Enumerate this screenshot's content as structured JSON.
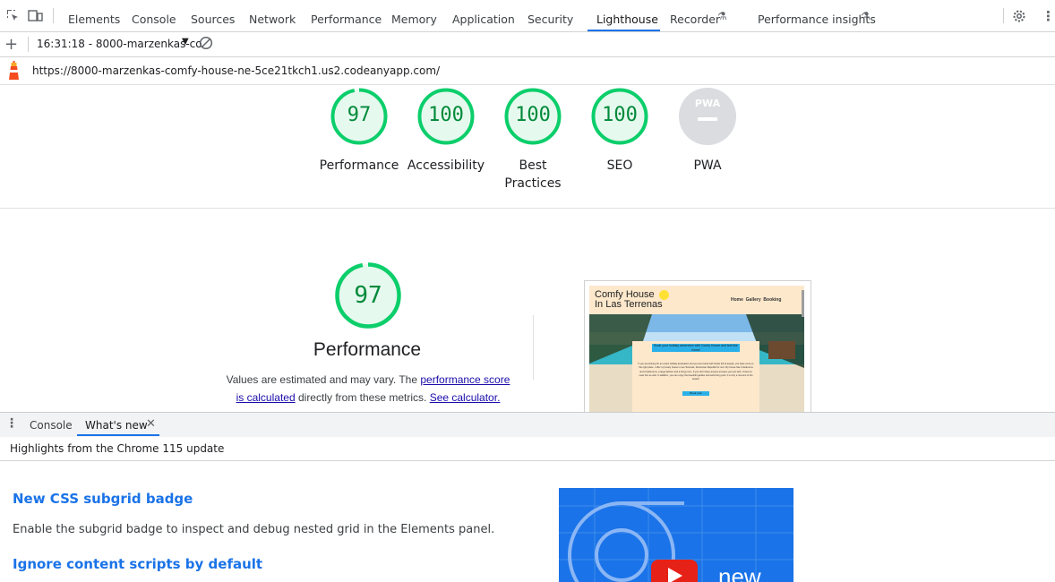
{
  "tabbar": {
    "tabs": [
      {
        "label": "Elements"
      },
      {
        "label": "Console"
      },
      {
        "label": "Sources"
      },
      {
        "label": "Network"
      },
      {
        "label": "Performance"
      },
      {
        "label": "Memory"
      },
      {
        "label": "Application"
      },
      {
        "label": "Security"
      },
      {
        "label": "Lighthouse"
      },
      {
        "label": "Recorder"
      },
      {
        "label": "Performance insights"
      }
    ],
    "active_tab": "Lighthouse"
  },
  "report_toolbar": {
    "report_select": "16:31:18 - 8000-marzenkas-co"
  },
  "url_bar": {
    "url": "https://8000-marzenkas-comfy-house-ne-5ce21tkch1.us2.codeanyapp.com/"
  },
  "scores": [
    {
      "label": "Performance",
      "value": "97",
      "color": "#0cce6b"
    },
    {
      "label": "Accessibility",
      "value": "100",
      "color": "#0cce6b"
    },
    {
      "label": "Best Practices",
      "value": "100",
      "color": "#0cce6b"
    },
    {
      "label": "SEO",
      "value": "100",
      "color": "#0cce6b"
    },
    {
      "label": "PWA",
      "value": "PWA",
      "color": "#dadce0"
    }
  ],
  "performance_detail": {
    "score": "97",
    "title": "Performance",
    "desc_prefix": "Values are estimated and may vary. The ",
    "link1": "performance score is calculated",
    "desc_mid": " directly from these metrics. ",
    "link2": "See calculator."
  },
  "screenshot_preview": {
    "site_title_line1": "Comfy House",
    "site_title_line2": "In Las Terrenas",
    "nav": "Home  Gallery  Booking",
    "card_heading": "Book your holiday adventure with Comfy House and feel like home!",
    "card_text": "If you are looking for an exotic holiday destination and you are bored with hotels full of people, you have come to the right place. I offer my lovely house in Las Terrenas, Dominican Republic for rent. My house has 4 bedrooms and 2 bathrooms, a large kitchen and a living room. If you don't have anyone to leave your pet with, I'd love to meet him as well. In addition, you can enjoy the beautiful garden and swimming pool. It is only a moment to the beach!",
    "card_button": "Book now"
  },
  "drawer": {
    "tabs": [
      {
        "label": "Console"
      },
      {
        "label": "What's new"
      }
    ],
    "highlights": "Highlights from the Chrome 115 update",
    "items": [
      {
        "heading": "New CSS subgrid badge",
        "text": "Enable the subgrid badge to inspect and debug nested grid in the Elements panel."
      },
      {
        "heading": "Ignore content scripts by default",
        "text": ""
      }
    ],
    "video_text": "new"
  }
}
